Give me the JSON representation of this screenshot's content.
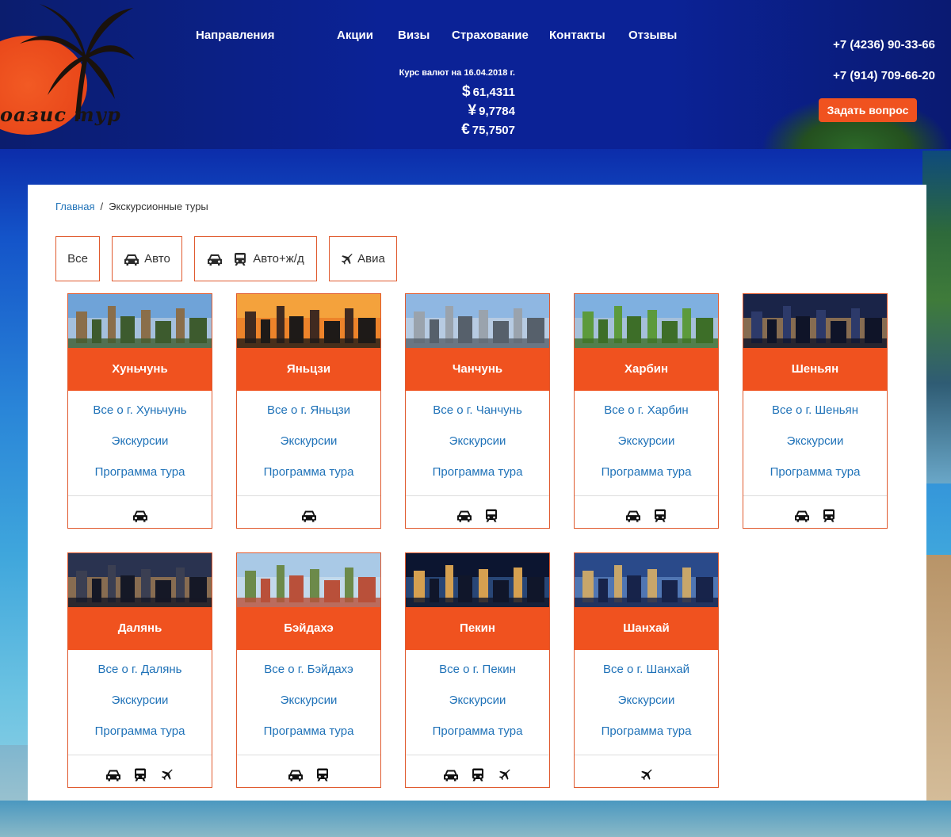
{
  "brand": {
    "logo_text": "оазис тур"
  },
  "nav": [
    {
      "label": "Направления"
    },
    {
      "label": "Акции"
    },
    {
      "label": "Визы"
    },
    {
      "label": "Страхование"
    },
    {
      "label": "Контакты"
    },
    {
      "label": "Отзывы"
    }
  ],
  "rates": {
    "date_label": "Курс валют на 16.04.2018 г.",
    "usd": {
      "symbol": "$",
      "value": "61,4311"
    },
    "cny": {
      "symbol": "¥",
      "value": "9,7784"
    },
    "eur": {
      "symbol": "€",
      "value": "75,7507"
    }
  },
  "contacts": {
    "phone1": "+7 (4236) 90-33-66",
    "phone2": "+7 (914) 709-66-20",
    "ask_button": "Задать вопрос"
  },
  "breadcrumb": {
    "home": "Главная",
    "separator": "/",
    "current": "Экскурсионные туры"
  },
  "filters": {
    "all": "Все",
    "auto": "Авто",
    "auto_rail": "Авто+ж/д",
    "avia": "Авиа"
  },
  "cards": [
    {
      "title": "Хуньчунь",
      "about": "Все о г. Хуньчунь",
      "excursions": "Экскурсии",
      "program": "Программа тура",
      "transport": [
        "car-icon"
      ]
    },
    {
      "title": "Яньцзи",
      "about": "Все о г. Яньцзи",
      "excursions": "Экскурсии",
      "program": "Программа тура",
      "transport": [
        "car-icon"
      ]
    },
    {
      "title": "Чанчунь",
      "about": "Все о г. Чанчунь",
      "excursions": "Экскурсии",
      "program": "Программа тура",
      "transport": [
        "car-icon",
        "train-icon"
      ]
    },
    {
      "title": "Харбин",
      "about": "Все о г. Харбин",
      "excursions": "Экскурсии",
      "program": "Программа тура",
      "transport": [
        "car-icon",
        "train-icon"
      ]
    },
    {
      "title": "Шеньян",
      "about": "Все о г. Шеньян",
      "excursions": "Экскурсии",
      "program": "Программа тура",
      "transport": [
        "car-icon",
        "train-icon"
      ]
    },
    {
      "title": "Далянь",
      "about": "Все о г. Далянь",
      "excursions": "Экскурсии",
      "program": "Программа тура",
      "transport": [
        "car-icon",
        "train-icon",
        "plane-icon"
      ]
    },
    {
      "title": "Бэйдахэ",
      "about": "Все о г. Бэйдахэ",
      "excursions": "Экскурсии",
      "program": "Программа тура",
      "transport": [
        "car-icon",
        "train-icon"
      ]
    },
    {
      "title": "Пекин",
      "about": "Все о г. Пекин",
      "excursions": "Экскурсии",
      "program": "Программа тура",
      "transport": [
        "car-icon",
        "train-icon",
        "plane-icon"
      ]
    },
    {
      "title": "Шанхай",
      "about": "Все о г. Шанхай",
      "excursions": "Экскурсии",
      "program": "Программа тура",
      "transport": [
        "plane-icon"
      ]
    }
  ],
  "colors": {
    "accent": "#f0521f",
    "link": "#1f72b8",
    "header_bg": "#0b2296",
    "card_border": "#e05a2e"
  }
}
